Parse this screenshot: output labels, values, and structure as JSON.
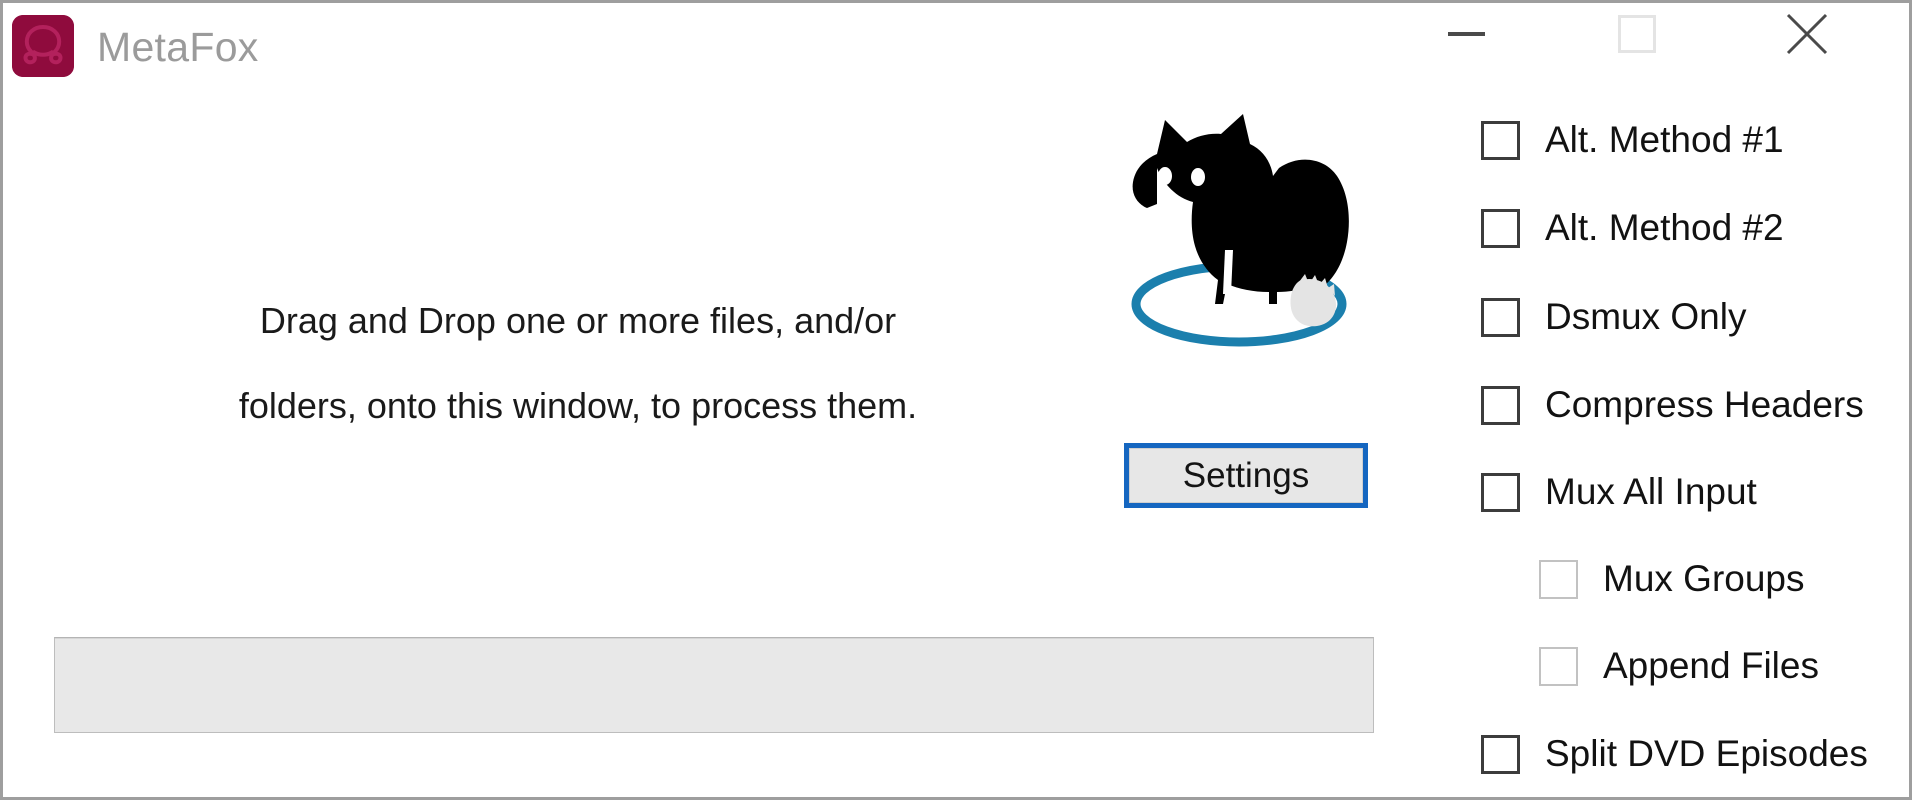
{
  "window": {
    "title": "MetaFox",
    "app_icon_name": "metafox-app-icon",
    "accent_color": "#1566c0",
    "logo_ring_color": "#1b7fad",
    "icon_background_color": "#8f0b3d",
    "title_color": "#9b9b9b"
  },
  "titlebar": {
    "minimize_label": "—",
    "maximize_label": "□",
    "close_label": "✕"
  },
  "main": {
    "drop_message_line1": "Drag and Drop one or more files, and/or",
    "drop_message_line2": "folders, onto this window, to process them.",
    "settings_label": "Settings",
    "logo_name": "metafox-fox-logo",
    "log_box_value": "",
    "log_box_placeholder": ""
  },
  "options": [
    {
      "label": "Alt. Method #1",
      "checked": false,
      "indented": false,
      "name": "alt-method-1"
    },
    {
      "label": "Alt. Method #2",
      "checked": false,
      "indented": false,
      "name": "alt-method-2"
    },
    {
      "label": "Dsmux Only",
      "checked": false,
      "indented": false,
      "name": "dsmux-only"
    },
    {
      "label": "Compress Headers",
      "checked": false,
      "indented": false,
      "name": "compress-headers"
    },
    {
      "label": "Mux All Input",
      "checked": false,
      "indented": false,
      "name": "mux-all-input"
    },
    {
      "label": "Mux Groups",
      "checked": false,
      "indented": true,
      "name": "mux-groups"
    },
    {
      "label": "Append Files",
      "checked": false,
      "indented": true,
      "name": "append-files"
    },
    {
      "label": "Split DVD Episodes",
      "checked": false,
      "indented": false,
      "name": "split-dvd-episodes"
    }
  ]
}
